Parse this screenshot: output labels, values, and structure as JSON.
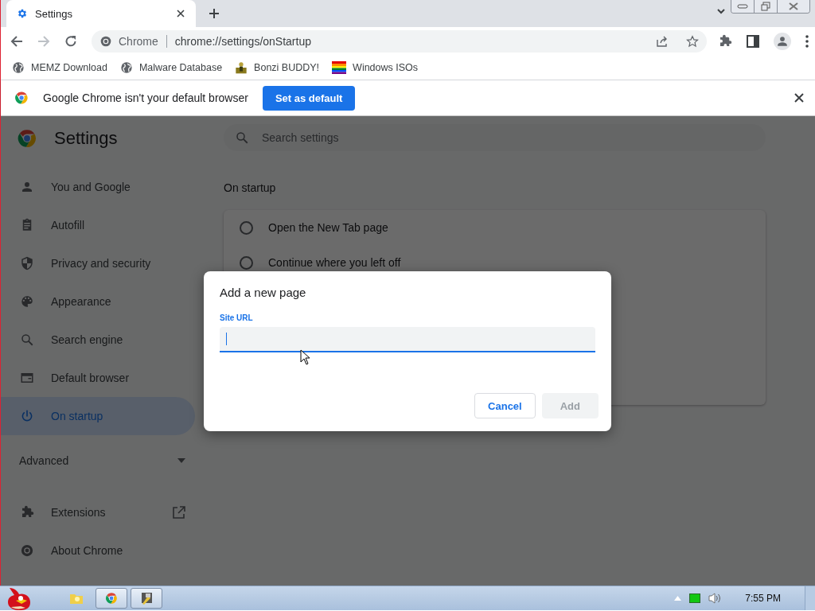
{
  "tab": {
    "title": "Settings"
  },
  "address": {
    "origin": "Chrome",
    "url": "chrome://settings/onStartup"
  },
  "bookmarks": [
    {
      "label": "MEMZ Download",
      "kind": "globe"
    },
    {
      "label": "Malware Database",
      "kind": "globe"
    },
    {
      "label": "Bonzi BUDDY!",
      "kind": "figure"
    },
    {
      "label": "Windows ISOs",
      "kind": "stripes"
    }
  ],
  "infobar": {
    "message": "Google Chrome isn't your default browser",
    "button": "Set as default"
  },
  "settings": {
    "title": "Settings",
    "search": {
      "placeholder": "Search settings"
    },
    "menu": [
      {
        "label": "You and Google",
        "kind": "person",
        "selected": false
      },
      {
        "label": "Autofill",
        "kind": "clipboard",
        "selected": false
      },
      {
        "label": "Privacy and security",
        "kind": "shield",
        "selected": false
      },
      {
        "label": "Appearance",
        "kind": "palette",
        "selected": false
      },
      {
        "label": "Search engine",
        "kind": "search",
        "selected": false
      },
      {
        "label": "Default browser",
        "kind": "browser",
        "selected": false
      },
      {
        "label": "On startup",
        "kind": "power",
        "selected": true
      }
    ],
    "advanced": {
      "label": "Advanced",
      "expanded": false
    },
    "links": [
      {
        "label": "Extensions",
        "kind": "puzzle",
        "external": true
      },
      {
        "label": "About Chrome",
        "kind": "chrome",
        "external": false
      }
    ]
  },
  "section": {
    "title": "On startup",
    "options": [
      {
        "label": "Open the New Tab page",
        "selected": false
      },
      {
        "label": "Continue where you left off",
        "selected": false
      }
    ]
  },
  "dialog": {
    "title": "Add a new page",
    "field_label": "Site URL",
    "buttons": [
      {
        "label": "Cancel",
        "disabled": false
      },
      {
        "label": "Add",
        "disabled": true
      }
    ]
  },
  "taskbar": {
    "clock": "7:55 PM"
  }
}
